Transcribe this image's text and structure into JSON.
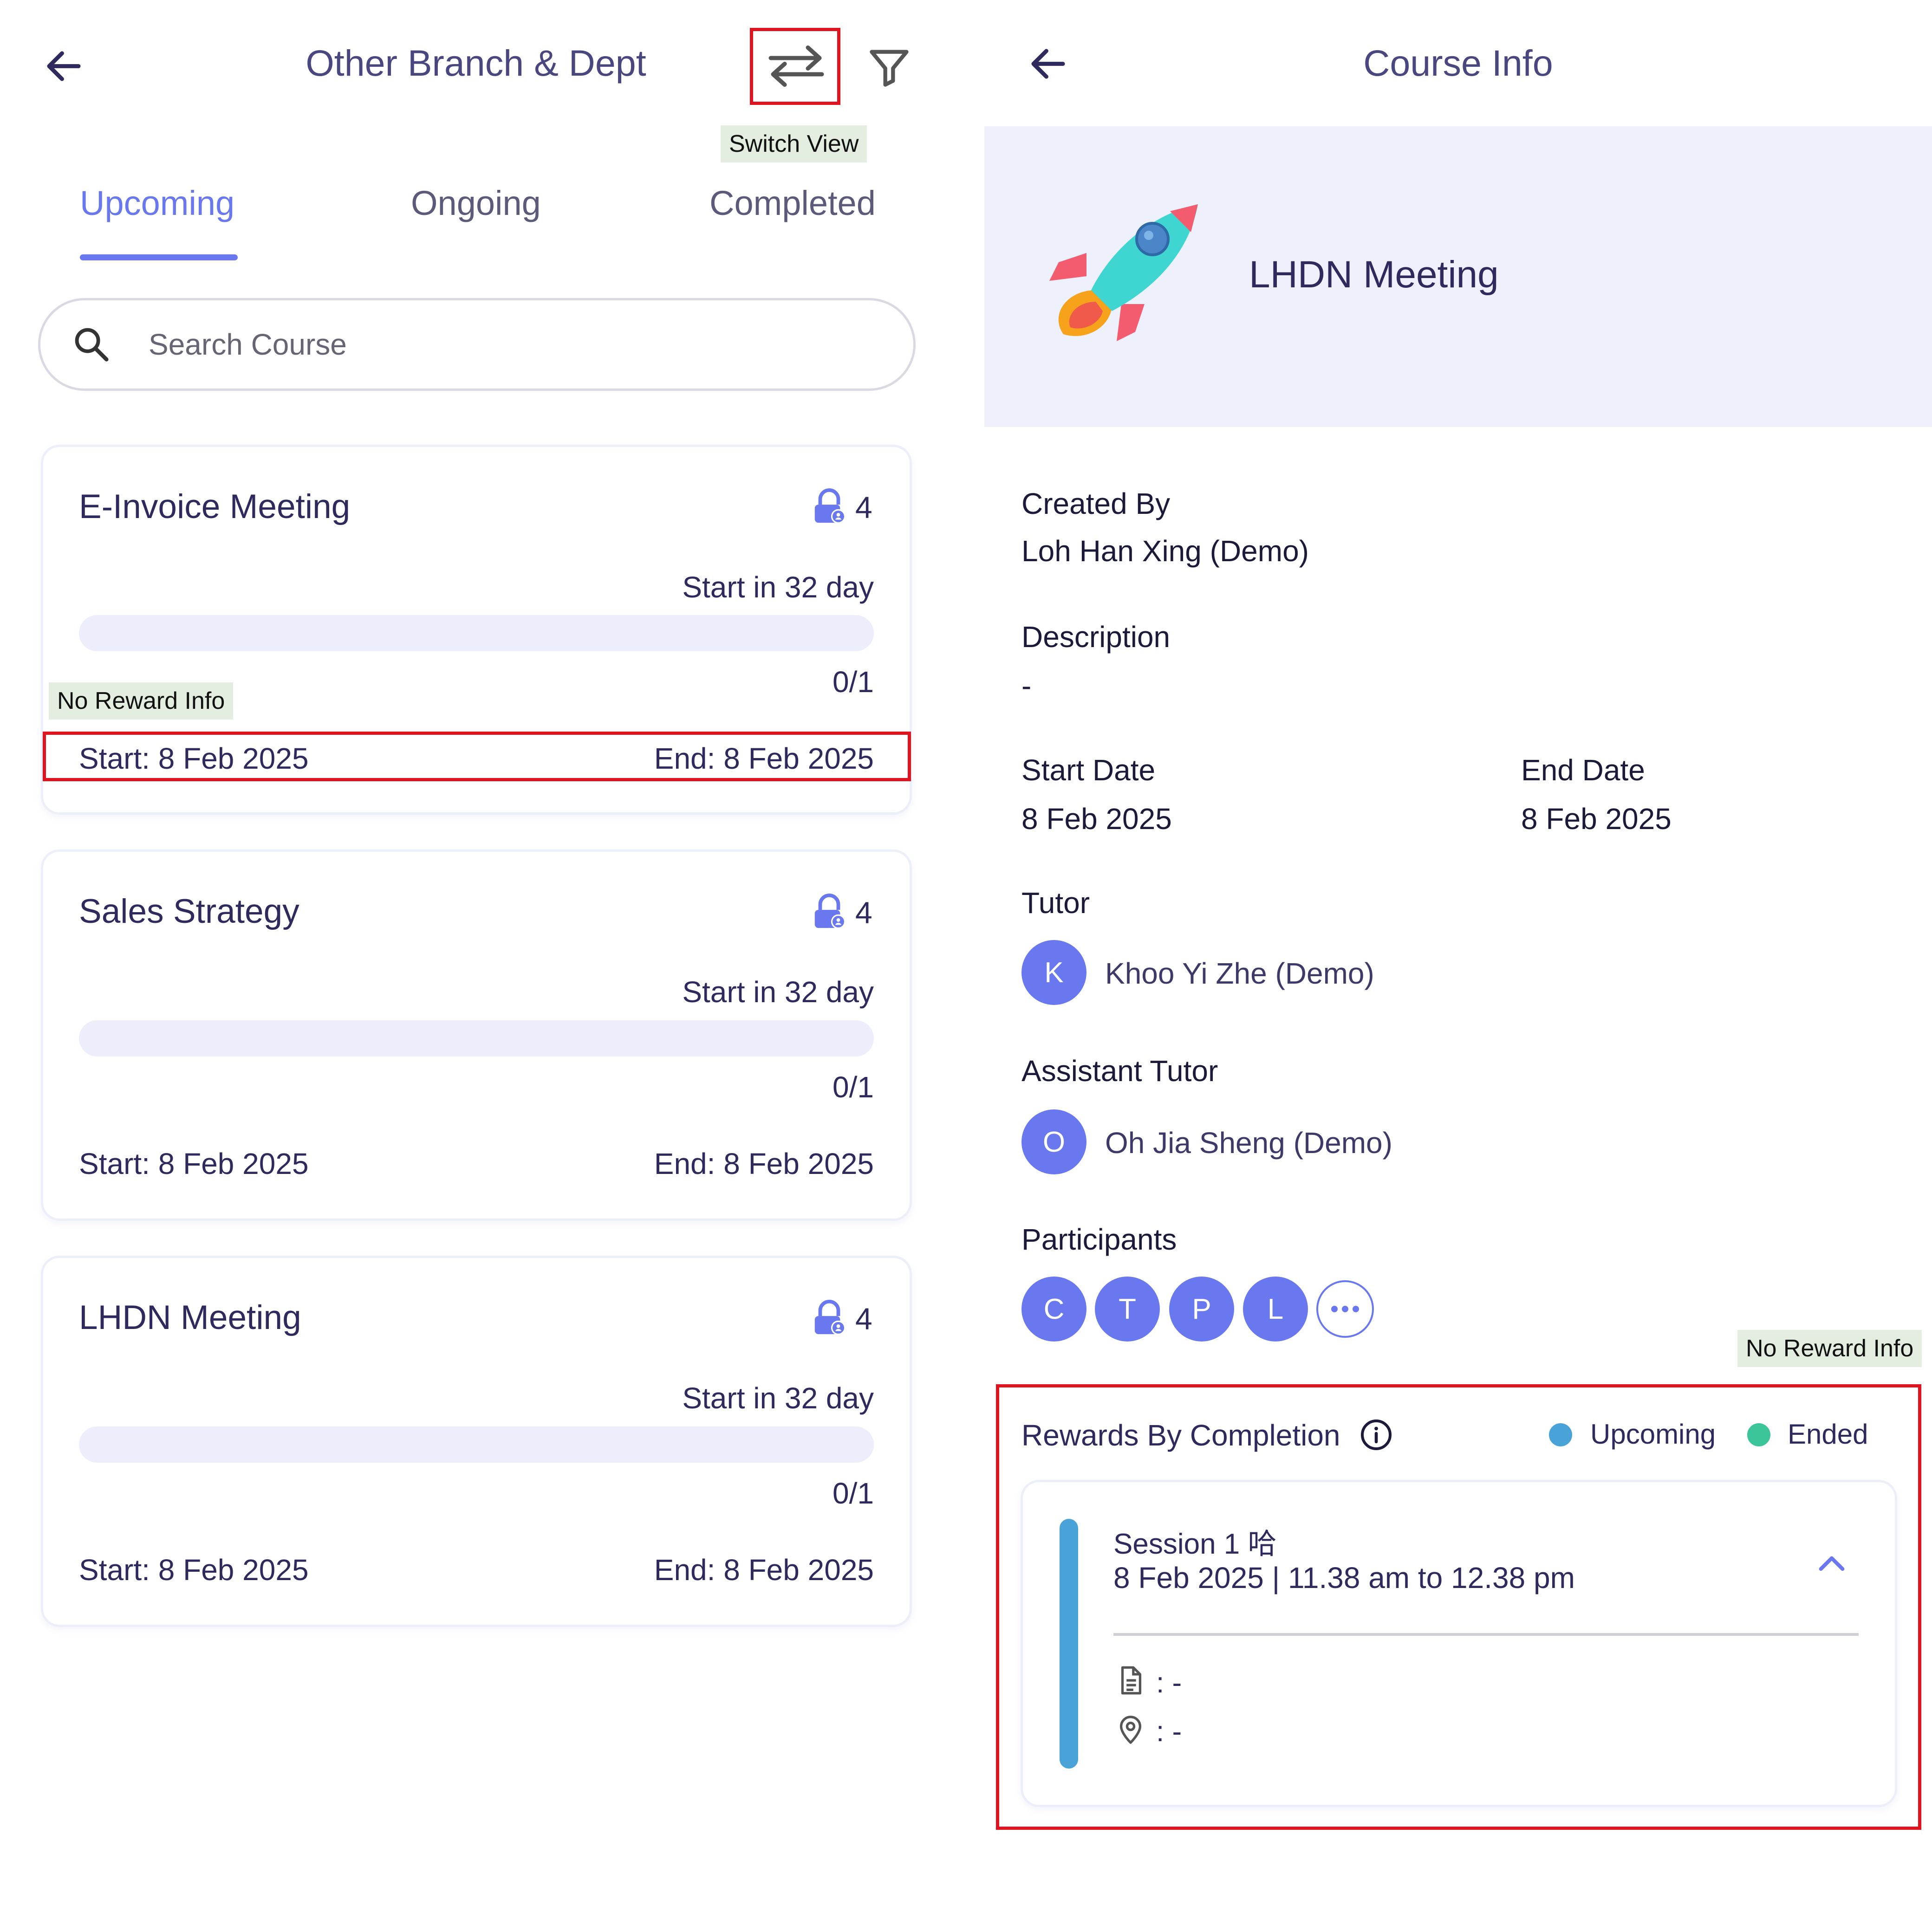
{
  "left": {
    "title": "Other Branch & Dept",
    "switch_view_tooltip": "Switch View",
    "tabs": [
      {
        "label": "Upcoming"
      },
      {
        "label": "Ongoing"
      },
      {
        "label": "Completed"
      }
    ],
    "search": {
      "placeholder": "Search Course"
    },
    "no_reward_info": "No Reward Info",
    "courses": [
      {
        "title": "E-Invoice Meeting",
        "count": "4",
        "start_in": "Start in 32 day",
        "progress": 0,
        "ratio": "0/1",
        "start": "Start: 8 Feb 2025",
        "end": "End: 8 Feb 2025"
      },
      {
        "title": "Sales Strategy",
        "count": "4",
        "start_in": "Start in 32 day",
        "progress": 0,
        "ratio": "0/1",
        "start": "Start: 8 Feb 2025",
        "end": "End: 8 Feb 2025"
      },
      {
        "title": "LHDN Meeting",
        "count": "4",
        "start_in": "Start in 32 day",
        "progress": 0,
        "ratio": "0/1",
        "start": "Start: 8 Feb 2025",
        "end": "End: 8 Feb 2025"
      }
    ]
  },
  "right": {
    "title": "Course Info",
    "course_name": "LHDN Meeting",
    "created_by": {
      "label": "Created By",
      "value": "Loh Han Xing (Demo)"
    },
    "description": {
      "label": "Description",
      "value": "-"
    },
    "start_date": {
      "label": "Start Date",
      "value": "8 Feb 2025"
    },
    "end_date": {
      "label": "End Date",
      "value": "8 Feb 2025"
    },
    "tutor": {
      "label": "Tutor",
      "initial": "K",
      "name": "Khoo Yi Zhe (Demo)"
    },
    "assistant_tutor": {
      "label": "Assistant Tutor",
      "initial": "O",
      "name": "Oh Jia Sheng (Demo)"
    },
    "participants": {
      "label": "Participants",
      "initials": [
        "C",
        "T",
        "P",
        "L"
      ]
    },
    "no_reward_info": "No Reward Info",
    "rewards": {
      "title": "Rewards By Completion",
      "legend": [
        {
          "label": "Upcoming",
          "color": "#4aa3d8"
        },
        {
          "label": "Ended",
          "color": "#3cc49a"
        }
      ],
      "session": {
        "title": "Session 1 哈",
        "time": "8 Feb 2025 | 11.38 am to 12.38 pm",
        "document": ": -",
        "location": ": -"
      }
    }
  },
  "colors": {
    "accent": "#6a78ef",
    "highlight_border": "#e0141e",
    "tooltip_bg": "#e3eee0"
  }
}
